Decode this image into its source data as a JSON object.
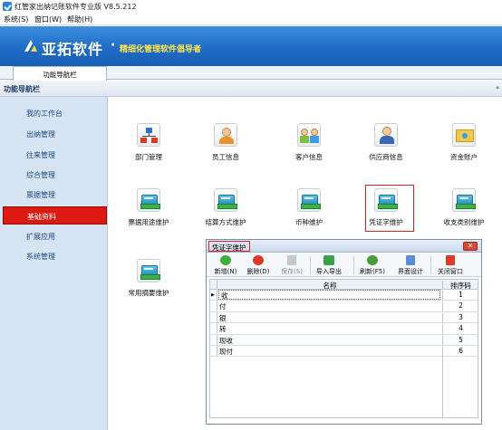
{
  "window": {
    "title": "红管家出纳记账软件专业版 V8.5.212"
  },
  "menu": [
    {
      "label": "系统(S)"
    },
    {
      "label": "窗口(W)"
    },
    {
      "label": "帮助(H)"
    }
  ],
  "banner": {
    "brand": "亚拓软件",
    "separator": "·",
    "slogan": "精细化管理软件倡导者"
  },
  "tabs": [
    {
      "label": "功能导航栏"
    }
  ],
  "nav_header": {
    "title": "功能导航栏",
    "collapse_glyph": "«"
  },
  "sidebar": {
    "items": [
      {
        "label": "我的工作台"
      },
      {
        "label": "出纳管理"
      },
      {
        "label": "往来管理"
      },
      {
        "label": "综合管理"
      },
      {
        "label": "票据管理"
      },
      {
        "label": "基础资料",
        "active": true
      },
      {
        "label": "扩展应用"
      },
      {
        "label": "系统管理"
      }
    ]
  },
  "modules": [
    {
      "label": "部门管理",
      "icon": "org-chart-icon"
    },
    {
      "label": "员工信息",
      "icon": "employee-icon"
    },
    {
      "label": "客户信息",
      "icon": "customer-icon"
    },
    {
      "label": "供应商信息",
      "icon": "supplier-icon"
    },
    {
      "label": "资金账户",
      "icon": "fund-account-icon"
    },
    {
      "label": "票据用途维护",
      "icon": "book-icon"
    },
    {
      "label": "结算方式维护",
      "icon": "book-icon"
    },
    {
      "label": "币种维护",
      "icon": "book-icon"
    },
    {
      "label": "凭证字维护",
      "icon": "book-icon",
      "highlighted": true
    },
    {
      "label": "收支类别维护",
      "icon": "book-icon"
    },
    {
      "label": "常用摘要维护",
      "icon": "book-icon"
    }
  ],
  "dialog": {
    "title": "凭证字维护",
    "close_glyph": "✕",
    "toolbar": [
      {
        "label": "新增(N)",
        "icon": "add-icon",
        "color": "#3fae3a"
      },
      {
        "label": "删除(D)",
        "icon": "delete-icon",
        "color": "#d93a2a"
      },
      {
        "label": "保存(S)",
        "icon": "save-icon",
        "color": "#b8c0c8",
        "disabled": true
      },
      {
        "label": "导入导出",
        "icon": "import-export-icon",
        "color": "#3aa14a"
      },
      {
        "label": "刷新(F5)",
        "icon": "refresh-icon",
        "color": "#4a9a3a"
      },
      {
        "label": "界面设计",
        "icon": "layout-design-icon",
        "color": "#5b8ed6"
      },
      {
        "label": "关闭窗口",
        "icon": "close-window-icon",
        "color": "#d93a2a"
      }
    ],
    "table": {
      "columns": [
        "名称",
        "排序码"
      ],
      "rows": [
        {
          "name": "收",
          "order": "1"
        },
        {
          "name": "付",
          "order": "2"
        },
        {
          "name": "银",
          "order": "3"
        },
        {
          "name": "转",
          "order": "4"
        },
        {
          "name": "现收",
          "order": "5"
        },
        {
          "name": "现付",
          "order": "6"
        }
      ]
    }
  },
  "colors": {
    "banner_blue": "#1f6cc5",
    "sidebar_bg": "#d6e4f4",
    "active_red": "#dd1a12",
    "slogan_yellow": "#ffe44d"
  }
}
